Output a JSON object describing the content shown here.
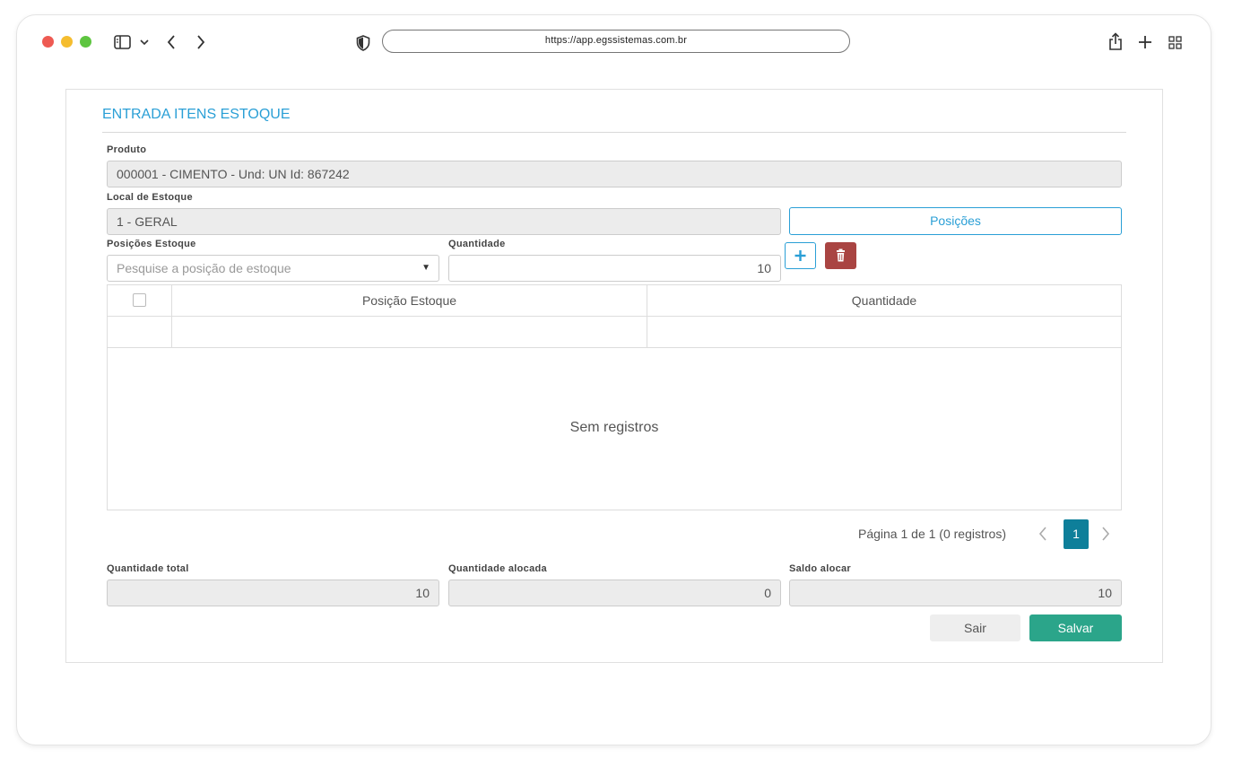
{
  "browser": {
    "url": "https://app.egssistemas.com.br",
    "icons": [
      "sidebar-icon",
      "chevron-down-icon",
      "back-icon",
      "forward-icon",
      "shield-icon",
      "share-icon",
      "new-tab-icon",
      "tabs-grid-icon"
    ]
  },
  "form": {
    "title": "ENTRADA ITENS ESTOQUE",
    "produto": {
      "label": "Produto",
      "value": "000001 - CIMENTO - Und: UN Id: 867242"
    },
    "local_estoque": {
      "label": "Local de Estoque",
      "value": "1 - GERAL"
    },
    "posicoes_button": "Posições",
    "posicoes_estoque": {
      "label": "Posições Estoque",
      "placeholder": "Pesquise a posição de estoque"
    },
    "quantidade": {
      "label": "Quantidade",
      "value": "10"
    }
  },
  "grid": {
    "columns": [
      "Posição Estoque",
      "Quantidade"
    ],
    "empty_text": "Sem registros"
  },
  "pager": {
    "text": "Página 1 de 1 (0 registros)",
    "current_page": "1"
  },
  "totals": {
    "total": {
      "label": "Quantidade total",
      "value": "10"
    },
    "alocada": {
      "label": "Quantidade alocada",
      "value": "0"
    },
    "saldo": {
      "label": "Saldo alocar",
      "value": "10"
    }
  },
  "actions": {
    "sair": "Sair",
    "salvar": "Salvar"
  },
  "colors": {
    "accent": "#2a9fd6",
    "delete": "#a94442",
    "save": "#2ba58a",
    "page_active": "#0e7f9a"
  }
}
